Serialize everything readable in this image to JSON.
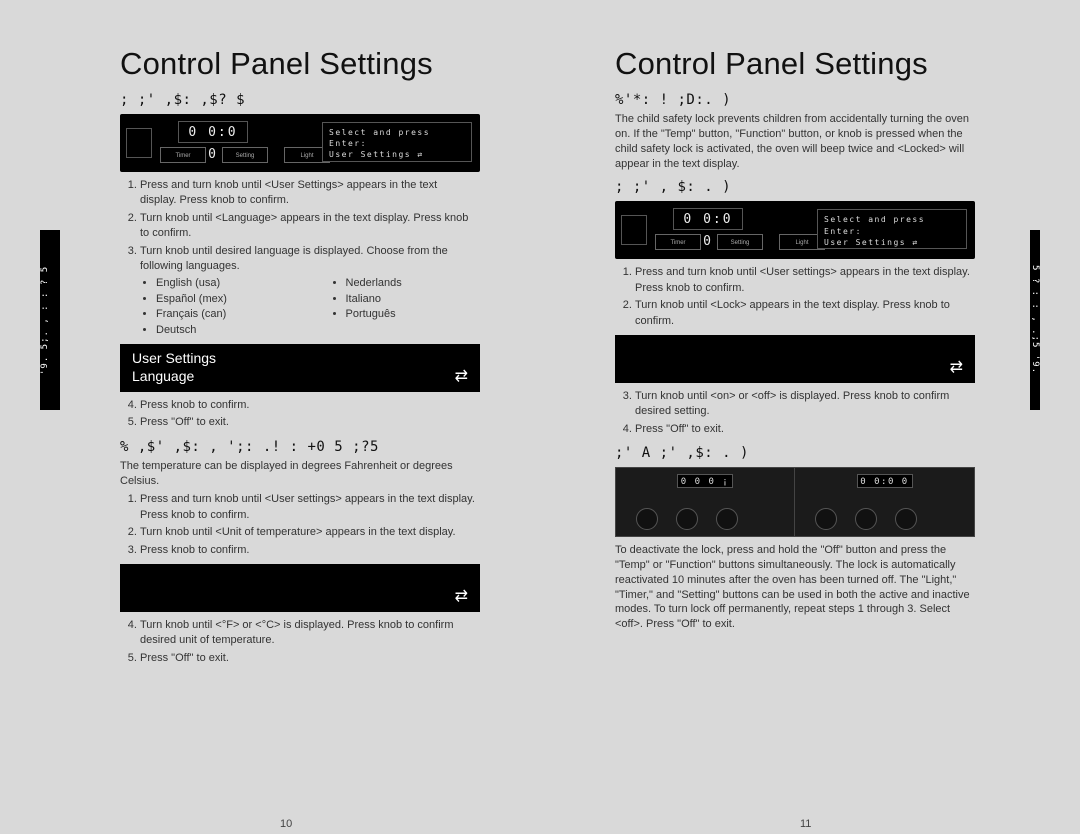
{
  "left": {
    "title": "Control Panel Settings",
    "sec1_heading": ";  ;' ,$:    ,$?   $",
    "panel_lcd": "0 0:0 0",
    "panel_text_line1": "Select  and  press  Enter:",
    "panel_text_line2": "User  Settings           ⇄",
    "steps_a": [
      "Press and turn knob until <User Settings> appears in the text display. Press knob to confirm.",
      "Turn knob until <Language> appears in the text display. Press knob to confirm.",
      "Turn knob until desired language is displayed. Choose from the following languages."
    ],
    "languages": [
      "English (usa)",
      "Nederlands",
      "Español (mex)",
      "Italiano",
      "Français (can)",
      "Português",
      "Deutsch"
    ],
    "textdisp_line1": "User Settings",
    "textdisp_line2": "Language",
    "steps_b": [
      "Press knob to confirm.",
      "Press \"Off\" to exit."
    ],
    "sec2_heading": "%  ,$' ,$: ,   ';: .! :    +0   5 ;?5",
    "sec2_intro": "The temperature can be displayed in degrees Fahrenheit or degrees Celsius.",
    "steps_c": [
      "Press and turn knob until <User settings> appears in the text display. Press knob to confirm.",
      "Turn knob until <Unit of temperature> appears in the text display.",
      "Press knob to confirm."
    ],
    "steps_d": [
      "Turn knob until <°F> or <°C> is displayed. Press knob to confirm desired unit of temperature.",
      "Press \"Off\" to exit."
    ],
    "page_no": "10"
  },
  "right": {
    "title": "Control Panel Settings",
    "sec1_heading": "%'*:     ! ;D:.   )",
    "sec1_intro": "The child safety lock prevents children from accidentally turning the oven on. If the \"Temp\" button, \"Function\" button, or knob is pressed when the child safety lock is activated, the oven will beep twice and <Locked> will appear in the text display.",
    "sec2_heading": "; ;' , $: .  )",
    "panel_lcd": "0 0:0 0",
    "panel_text_line1": "Select  and  press  Enter:",
    "panel_text_line2": "User  Settings           ⇄",
    "steps_a": [
      "Press and turn knob until <User settings> appears in the text display. Press knob to confirm.",
      "Turn knob until <Lock> appears in the text display. Press knob to confirm."
    ],
    "steps_b": [
      "Turn knob until <on> or <off> is displayed. Press knob to confirm desired setting.",
      "Press \"Off\" to exit."
    ],
    "sec3_heading": ";'  A  ;' ,$:  .  )",
    "dbl_lcd_left": "0 0 0 ¡",
    "dbl_lcd_right": "0 0:0 0",
    "sec3_body": "To deactivate the lock, press and hold the \"Off\" button and press the \"Temp\" or \"Function\" buttons simultaneously. The lock is automatically reactivated 10 minutes after the oven has been turned off. The \"Light,\" \"Timer,\" and \"Setting\" buttons can be used in both the active and inactive modes. To turn lock off permanently, repeat steps 1 through 3. Select <off>. Press \"Off\" to exit.",
    "page_no": "11"
  },
  "side_tab_left": "'9.  5;. , : :   ?   5",
  "side_tab_right": "5    ?   : : ,  .;5  '9.",
  "swap_icon": "⇄"
}
